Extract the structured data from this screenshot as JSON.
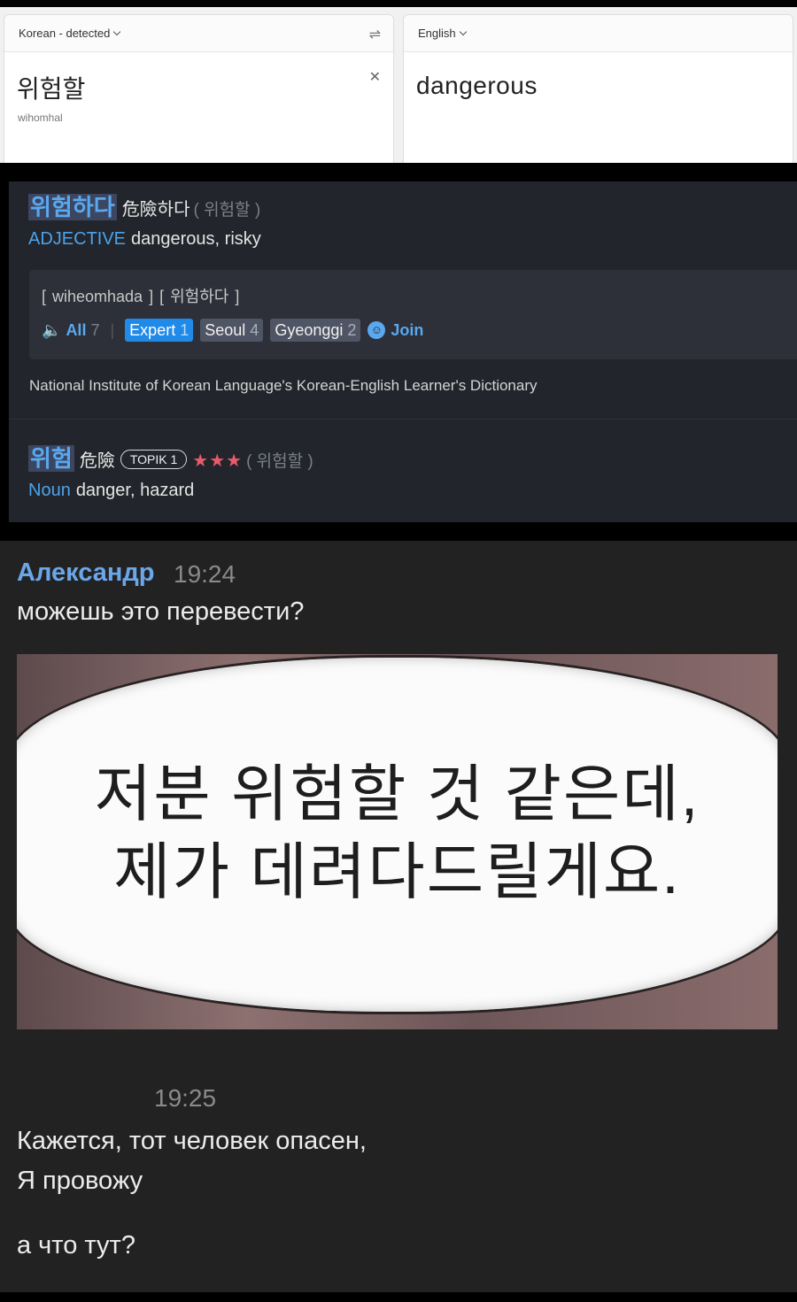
{
  "translator": {
    "source_lang": "Korean - detected",
    "target_lang": "English",
    "source_text": "위험할",
    "romanization": "wihomhal",
    "translation": "dangerous"
  },
  "dictionary": {
    "entry1": {
      "headword": "위험하다",
      "hanja": "危險하다",
      "form": "( 위험할 )",
      "pos": "ADJECTIVE",
      "definition": "dangerous, risky",
      "pronunciation": "[ wiheomhada ]   [ 위험하다 ]",
      "audio": {
        "all_label": "All",
        "all_count": "7",
        "tags": [
          {
            "label": "Expert",
            "count": "1"
          },
          {
            "label": "Seoul",
            "count": "4"
          },
          {
            "label": "Gyeonggi",
            "count": "2"
          }
        ],
        "join_label": "Join"
      },
      "source": "National Institute of Korean Language's Korean-English Learner's Dictionary"
    },
    "entry2": {
      "headword": "위험",
      "hanja": "危險",
      "badge": "TOPIK 1",
      "stars": "★★★",
      "form": "( 위험할 )",
      "pos": "Noun",
      "definition": "danger, hazard"
    }
  },
  "chat": {
    "author": "Александр",
    "time1": "19:24",
    "message1": "можешь это перевести?",
    "image_text_line1": "저분 위험할 것 같은데,",
    "image_text_line2": "제가 데려다드릴게요.",
    "time2": "19:25",
    "message2_line1": "Кажется, тот человек опасен,",
    "message2_line2": "Я провожу",
    "message3": "а что тут?"
  },
  "colors": {
    "accent_blue": "#4da3ea",
    "author_blue": "#6ca6e8",
    "star_red": "#e85b6c",
    "dict_bg": "#22252b",
    "chat_bg": "#222223"
  },
  "icons": [
    "chevron-down-icon",
    "swap-icon",
    "close-icon",
    "speaker-icon",
    "user-icon",
    "star-icon"
  ]
}
